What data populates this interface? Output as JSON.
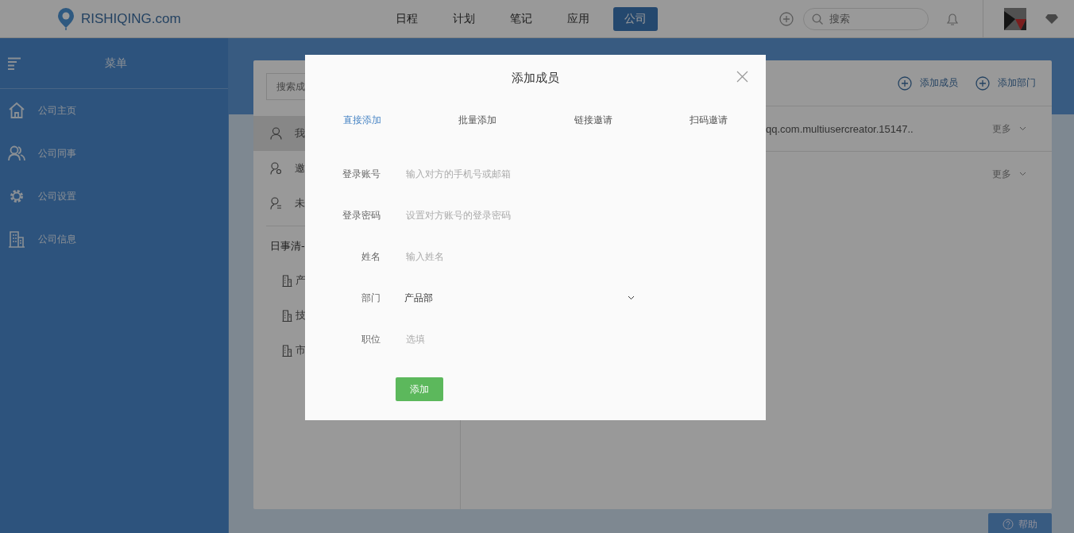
{
  "topbar": {
    "logo": "RISHIQING.com",
    "nav": [
      {
        "label": "日程",
        "selected": false
      },
      {
        "label": "计划",
        "selected": false
      },
      {
        "label": "笔记",
        "selected": false
      },
      {
        "label": "应用",
        "selected": false
      },
      {
        "label": "公司",
        "selected": true
      }
    ],
    "search": {
      "placeholder": "搜索"
    }
  },
  "sidebar": {
    "title": "菜单",
    "items": [
      {
        "label": "公司主页",
        "kind": "home"
      },
      {
        "label": "公司同事",
        "kind": "people"
      },
      {
        "label": "公司设置",
        "kind": "gear"
      },
      {
        "label": "公司信息",
        "kind": "building"
      }
    ]
  },
  "members_panel": {
    "search": {
      "placeholder": "搜索成"
    },
    "groups": [
      {
        "label": "我",
        "kind": "user",
        "selected": true
      },
      {
        "label": "邀",
        "kind": "invite",
        "selected": false
      },
      {
        "label": "未",
        "kind": "pending",
        "selected": false
      }
    ],
    "company": "日事清-",
    "departments": [
      "产",
      "技",
      "市"
    ]
  },
  "toolbar": {
    "buttons": [
      "添加成员",
      "添加部门"
    ]
  },
  "members": [
    {
      "account": "qq.com.multiusercreator.15147..",
      "action": "更多"
    },
    {
      "action": "更多"
    }
  ],
  "modal": {
    "title": "添加成员",
    "tabs": [
      {
        "label": "直接添加",
        "selected": true
      },
      {
        "label": "批量添加",
        "selected": false
      },
      {
        "label": "链接邀请",
        "selected": false
      },
      {
        "label": "扫码邀请",
        "selected": false
      }
    ],
    "fields": [
      {
        "label": "登录账号",
        "kind": "text",
        "placeholder": "输入对方的手机号或邮箱"
      },
      {
        "label": "登录密码",
        "kind": "password",
        "placeholder": "设置对方账号的登录密码"
      },
      {
        "label": "姓名",
        "kind": "text",
        "placeholder": "输入姓名"
      },
      {
        "label": "部门",
        "kind": "select",
        "value": "产品部"
      },
      {
        "label": "职位",
        "kind": "text",
        "placeholder": "选填"
      }
    ],
    "submit": "添加"
  },
  "help": "帮助"
}
